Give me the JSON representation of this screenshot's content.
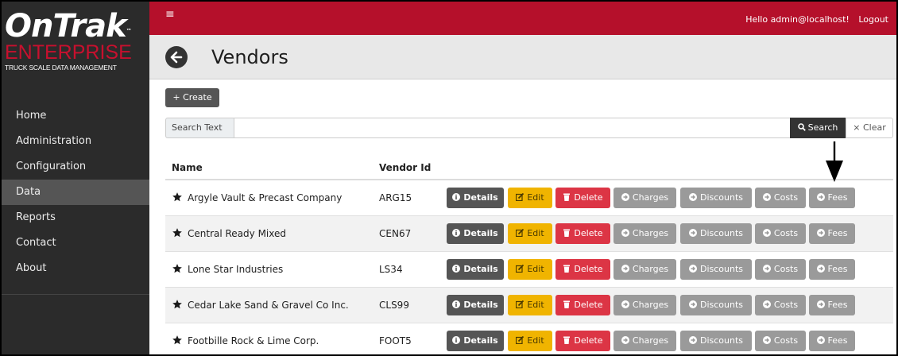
{
  "brand": {
    "name": "OnTrak",
    "tm": "™",
    "edition": "ENTERPRISE",
    "tagline": "TRUCK SCALE DATA MANAGEMENT"
  },
  "sidebar": {
    "items": [
      {
        "label": "Home",
        "active": false
      },
      {
        "label": "Administration",
        "active": false
      },
      {
        "label": "Configuration",
        "active": false
      },
      {
        "label": "Data",
        "active": true
      },
      {
        "label": "Reports",
        "active": false
      },
      {
        "label": "Contact",
        "active": false
      },
      {
        "label": "About",
        "active": false
      }
    ]
  },
  "topbar": {
    "menu_glyph": "≡",
    "greeting": "Hello admin@localhost!",
    "logout_label": "Logout"
  },
  "header": {
    "title": "Vendors"
  },
  "toolbar": {
    "create_label": "+ Create"
  },
  "search": {
    "label": "Search Text",
    "value": "",
    "search_label": "Search",
    "clear_label": "× Clear"
  },
  "table": {
    "columns": [
      "Name",
      "Vendor Id"
    ],
    "action_labels": {
      "details": "Details",
      "edit": "Edit",
      "delete": "Delete",
      "charges": "Charges",
      "discounts": "Discounts",
      "costs": "Costs",
      "fees": "Fees"
    },
    "rows": [
      {
        "name": "Argyle Vault & Precast Company",
        "vendor_id": "ARG15"
      },
      {
        "name": "Central Ready Mixed",
        "vendor_id": "CEN67"
      },
      {
        "name": "Lone Star Industries",
        "vendor_id": "LS34"
      },
      {
        "name": "Cedar Lake Sand & Gravel Co Inc.",
        "vendor_id": "CLS99"
      },
      {
        "name": "Footbille Rock & Lime Corp.",
        "vendor_id": "FOOT5"
      }
    ]
  },
  "colors": {
    "topbar": "#b5102b",
    "sidebar": "#2b2b2b",
    "details": "#555555",
    "edit": "#f0b400",
    "delete": "#dc3545",
    "secondary": "#9a9a9a"
  }
}
